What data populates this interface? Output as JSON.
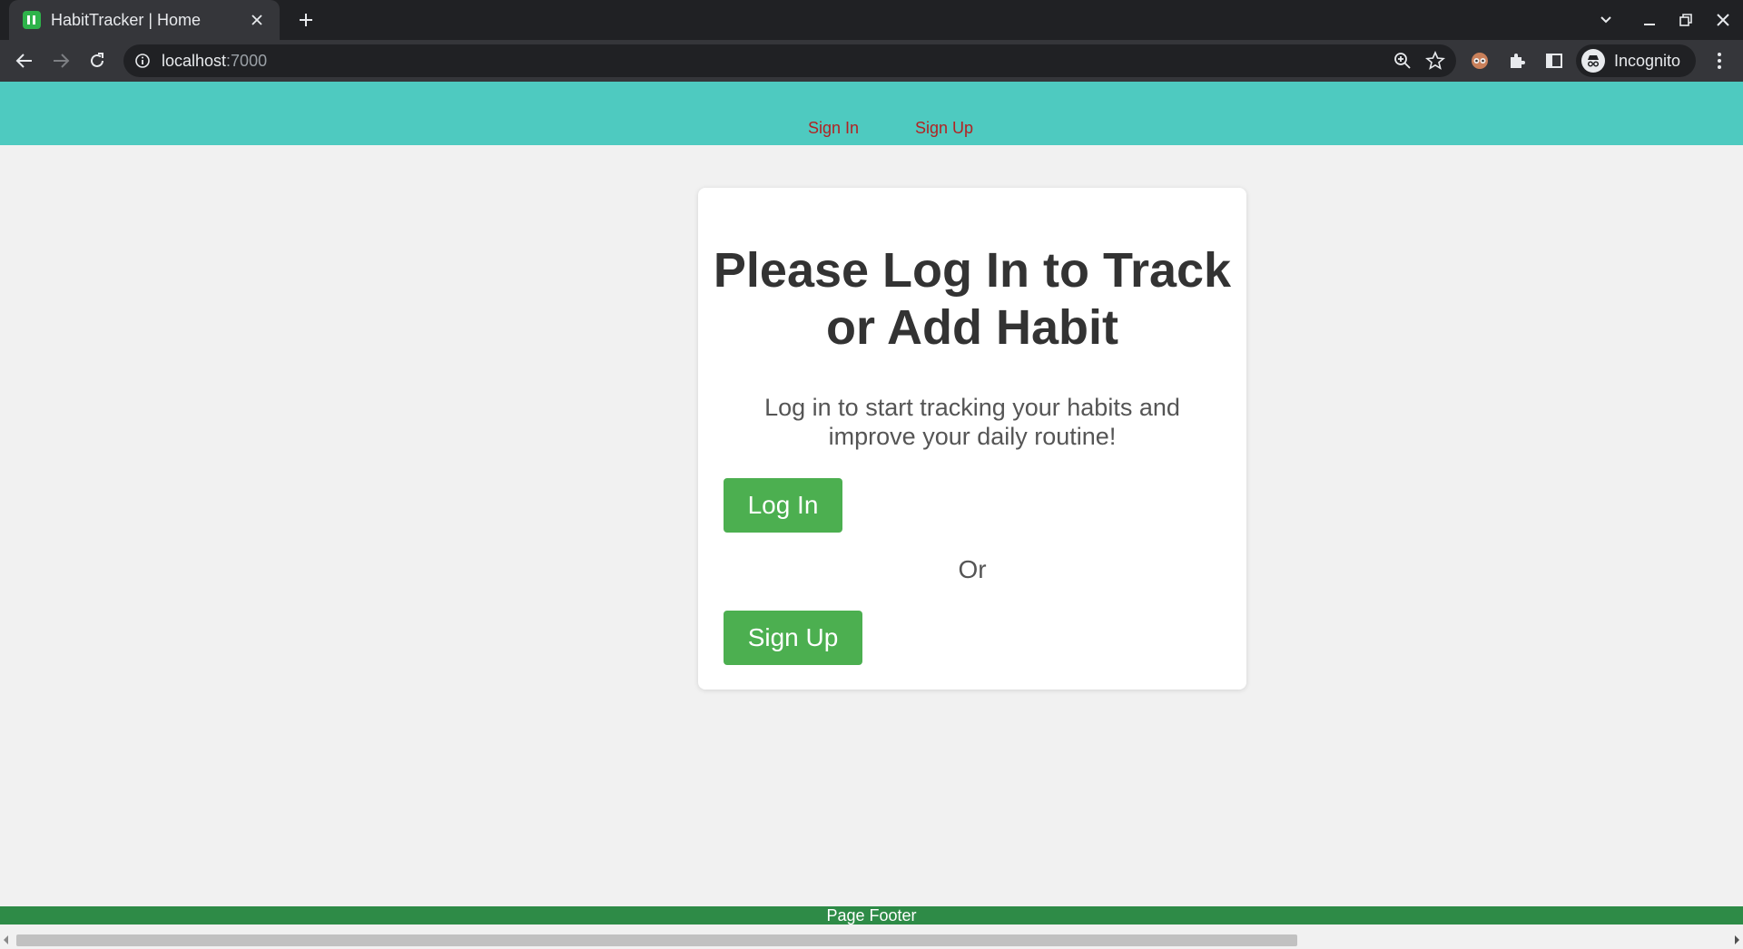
{
  "browser": {
    "tab_title": "HabitTracker | Home",
    "url_host": "localhost",
    "url_port": ":7000",
    "profile_label": "Incognito"
  },
  "nav": {
    "sign_in": "Sign In",
    "sign_up": "Sign Up"
  },
  "card": {
    "heading": "Please Log In to Track or Add Habit",
    "subtitle": "Log in to start tracking your habits and improve your daily routine!",
    "login_label": "Log In",
    "or_label": "Or",
    "signup_label": "Sign Up"
  },
  "footer": {
    "text": "Page Footer"
  },
  "colors": {
    "nav_bg": "#4ecac0",
    "nav_link": "#b22222",
    "button_bg": "#4caf50",
    "footer_bg": "#2e8b47",
    "page_bg": "#f1f1f1"
  }
}
